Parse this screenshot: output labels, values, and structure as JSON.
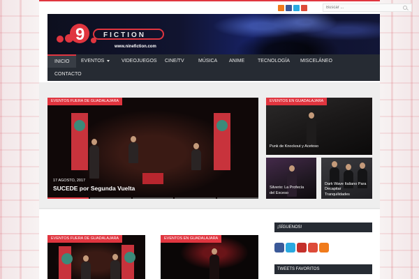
{
  "topbar": {
    "social_colors": [
      "#f07b1c",
      "#3b5998",
      "#2aa9e0",
      "#dd4b39"
    ],
    "social_icons": [
      "rss-icon",
      "facebook-icon",
      "twitter-icon",
      "google-plus-icon"
    ],
    "search_placeholder": "Buscar ..."
  },
  "header": {
    "logo_text": "FICTION",
    "logo_number": "9",
    "site_url": "www.ninefiction.com"
  },
  "nav": {
    "items": [
      {
        "label": "INICIO",
        "active": true
      },
      {
        "label": "EVENTOS",
        "dropdown": true
      },
      {
        "label": "VIDEOJUEGOS"
      },
      {
        "label": "CINE/TV"
      },
      {
        "label": "MÚSICA"
      },
      {
        "label": "ANIME"
      },
      {
        "label": "TECNOLOGÍA"
      },
      {
        "label": "MISCELÁNEO"
      },
      {
        "label": "CONTACTO"
      }
    ]
  },
  "featured": {
    "main": {
      "category": "EVENTOS FUERA DE GUADALAJARA",
      "date": "17 AGOSTO, 2017",
      "title": "SUCEDE por Segunda Vuelta"
    },
    "side_top": {
      "category": "EVENTOS EN GUADALAJARA",
      "title": "Punk de Knockout y Acetoso"
    },
    "side_bottom_left": {
      "title_line1": "Silverio: La Profecía",
      "title_line2": "del Exceso"
    },
    "side_bottom_right": {
      "title_line1": "Dark Wave Italiano Para Decapitar",
      "title_line2": "Tranquilidades"
    }
  },
  "lower": {
    "card1_category": "EVENTOS FUERA DE GUADALAJARA",
    "card2_category": "EVENTOS EN GUADALAJARA"
  },
  "sidebar": {
    "follow_heading": "¡SÍGUENOS!",
    "social_colors": [
      "#3b5998",
      "#2aa9e0",
      "#c4302b",
      "#dd4b39",
      "#f07b1c"
    ],
    "social_icons": [
      "facebook-icon",
      "twitter-icon",
      "youtube-icon",
      "google-plus-icon",
      "rss-icon"
    ],
    "tweets_heading": "TWEETS FAVORITOS"
  },
  "colors": {
    "accent": "#e0353f",
    "nav_bg": "#262b33"
  }
}
